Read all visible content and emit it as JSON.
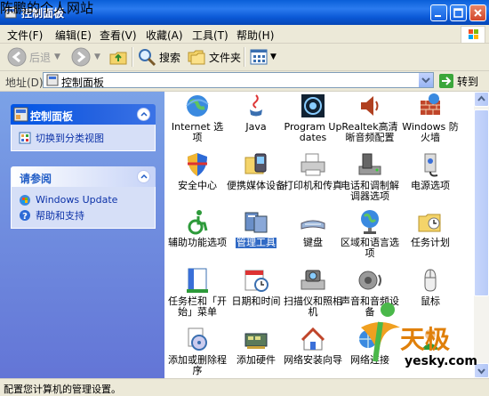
{
  "overlay_text": "陈鹏的个人网站",
  "window": {
    "title": "控制面板"
  },
  "menu": [
    "文件(F)",
    "编辑(E)",
    "查看(V)",
    "收藏(A)",
    "工具(T)",
    "帮助(H)"
  ],
  "toolbar": {
    "back_label": "后退",
    "search_label": "搜索",
    "folders_label": "文件夹"
  },
  "address": {
    "label": "地址(D)",
    "value": "控制面板",
    "go_label": "转到"
  },
  "left_pane": {
    "panel_box": {
      "title": "控制面板",
      "link": "切换到分类视图"
    },
    "see_also_box": {
      "title": "请参阅",
      "links": [
        "Windows Update",
        "帮助和支持"
      ]
    }
  },
  "icons": [
    {
      "label": "Internet 选项",
      "icon": "globe-icon"
    },
    {
      "label": "Java",
      "icon": "java-icon"
    },
    {
      "label": "Program Updates",
      "icon": "program-updates-icon"
    },
    {
      "label": "Realtek高清晰音频配置",
      "icon": "speaker-icon"
    },
    {
      "label": "Windows 防火墙",
      "icon": "firewall-icon"
    },
    {
      "label": "安全中心",
      "icon": "shield-icon"
    },
    {
      "label": "便携媒体设备",
      "icon": "media-device-icon"
    },
    {
      "label": "打印机和传真",
      "icon": "printer-icon"
    },
    {
      "label": "电话和调制解调器选项",
      "icon": "phone-modem-icon"
    },
    {
      "label": "电源选项",
      "icon": "power-icon"
    },
    {
      "label": "辅助功能选项",
      "icon": "accessibility-icon"
    },
    {
      "label": "管理工具",
      "icon": "admin-tools-icon",
      "selected": true
    },
    {
      "label": "键盘",
      "icon": "keyboard-icon"
    },
    {
      "label": "区域和语言选项",
      "icon": "region-globe-icon"
    },
    {
      "label": "任务计划",
      "icon": "scheduled-tasks-icon"
    },
    {
      "label": "任务栏和「开始」菜单",
      "icon": "taskbar-icon"
    },
    {
      "label": "日期和时间",
      "icon": "clock-icon"
    },
    {
      "label": "扫描仪和照相机",
      "icon": "scanner-icon"
    },
    {
      "label": "声音和音频设备",
      "icon": "sound-icon"
    },
    {
      "label": "鼠标",
      "icon": "mouse-icon"
    },
    {
      "label": "添加或删除程序",
      "icon": "add-remove-icon"
    },
    {
      "label": "添加硬件",
      "icon": "add-hardware-icon"
    },
    {
      "label": "网络安装向导",
      "icon": "network-setup-icon"
    },
    {
      "label": "网络连接",
      "icon": "network-icon"
    },
    {
      "label": "",
      "icon": "user-icon"
    }
  ],
  "status": {
    "text": "配置您计算机的管理设置。"
  },
  "watermark": {
    "brand": "天极",
    "site": "yesky.com"
  },
  "colors": {
    "titlebar": "#0a58d6",
    "task_pane": "#7ba2e7",
    "selection": "#316ac5"
  }
}
